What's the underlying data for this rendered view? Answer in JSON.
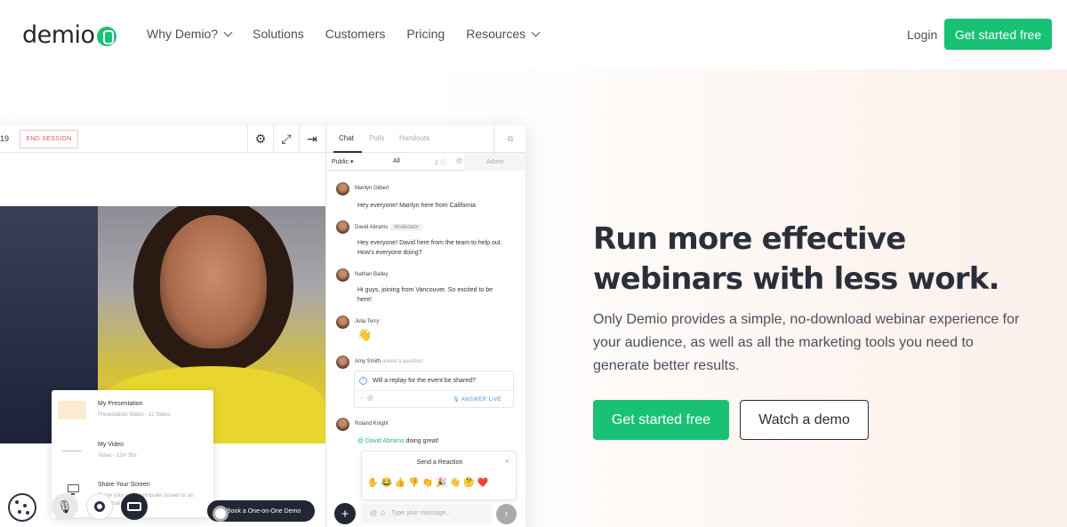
{
  "nav": {
    "logo": "demio",
    "links": [
      "Why Demio?",
      "Solutions",
      "Customers",
      "Pricing",
      "Resources"
    ],
    "login": "Login",
    "cta": "Get started free"
  },
  "app": {
    "timer": "19",
    "end_session": "END SESSION",
    "tools": [
      "gear-icon",
      "expand-icon",
      "exit-icon"
    ],
    "chat_tabs": [
      "Chat",
      "Polls",
      "Handouts"
    ],
    "filter": {
      "public": "Public",
      "all": "All",
      "count": "1",
      "admin": "Admin"
    },
    "popup": [
      {
        "title": "My Presentation",
        "sub": "Presentation Slides - 12 Slides"
      },
      {
        "title": "My Video",
        "sub": "Video - 12m 35s"
      },
      {
        "title": "Share Your Screen",
        "sub": "Share your entire computer screen or an individual window."
      }
    ],
    "messages": [
      {
        "name": "Marilyn Gilbert",
        "text": "Hey everyone! Marilyn here from California"
      },
      {
        "name": "David Abrams",
        "tag": "Moderator",
        "text": "Hey everyone! David here from the team to help out. How's everyone doing?"
      },
      {
        "name": "Nathan Bailey",
        "text": "Hi guys, joining from Vancouver. So excited to be here!"
      },
      {
        "name": "Julia Terry",
        "text": "👋"
      },
      {
        "name": "Amy Smith",
        "meta": "asked a question"
      },
      {
        "name": "Roland Knight",
        "mention": "@ David Abrams",
        "text": " doing great!"
      }
    ],
    "question": "Will a replay for the event be shared?",
    "answer_live": "ANSWER LIVE",
    "reaction_title": "Send a Reaction",
    "reaction_emojis": "✋😂👍👎👏🎉👋🤔❤️",
    "input_placeholder": "Type your message...",
    "book_demo": "Book a One-on-One Demo"
  },
  "hero": {
    "title": "Run more effective webinars with less work.",
    "subtitle": "Only Demio provides a simple, no-download webinar experience for your audience, as well as all the marketing tools you need to generate better results.",
    "cta_primary": "Get started free",
    "cta_secondary": "Watch a demo"
  },
  "colors": {
    "brand": "#19c174",
    "text": "#2b2f3a"
  }
}
